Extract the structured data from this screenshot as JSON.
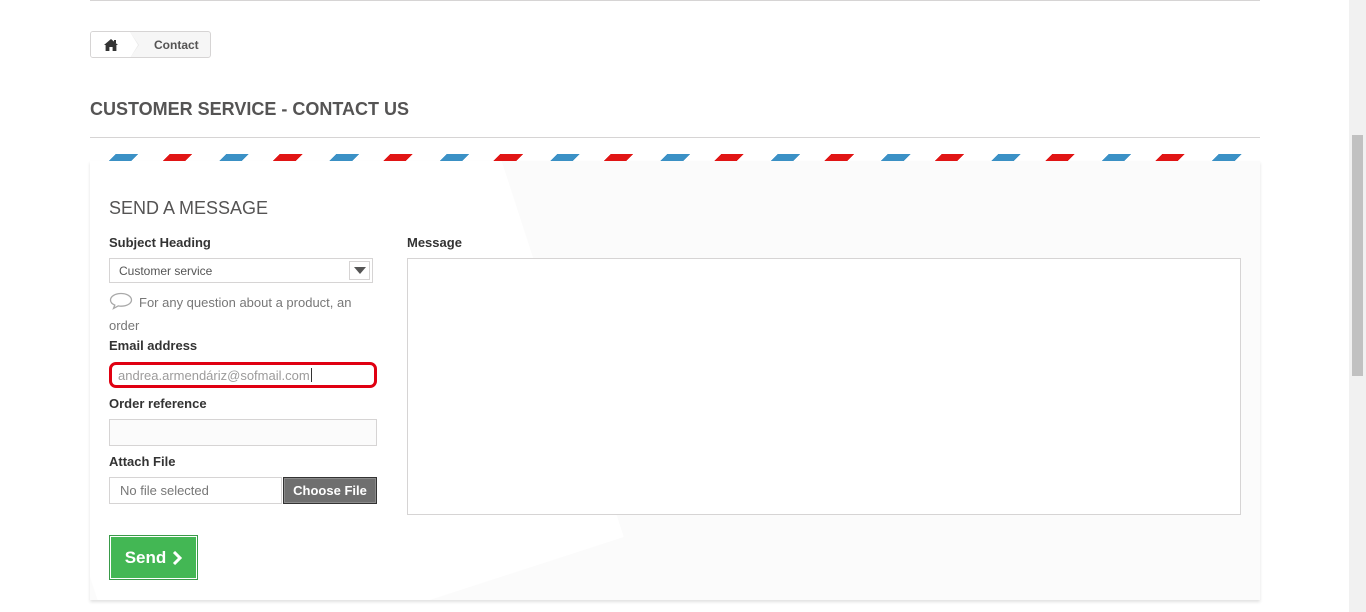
{
  "breadcrumb": {
    "home_icon": "home-icon",
    "current": "Contact"
  },
  "page": {
    "heading": "CUSTOMER SERVICE - CONTACT US"
  },
  "form": {
    "title": "SEND A MESSAGE",
    "subject": {
      "label": "Subject Heading",
      "selected": "Customer service",
      "hint": "For any question about a product, an order"
    },
    "email": {
      "label": "Email address",
      "value": "andrea.armendáriz@sofmail.com"
    },
    "order_reference": {
      "label": "Order reference",
      "value": ""
    },
    "attach": {
      "label": "Attach File",
      "file_status": "No file selected",
      "button_label": "Choose File"
    },
    "message": {
      "label": "Message",
      "value": ""
    },
    "send_label": "Send"
  },
  "colors": {
    "stripe_red": "#e11515",
    "stripe_blue": "#3b91c6",
    "send_green": "#43b754",
    "focus_red": "#e00011"
  }
}
